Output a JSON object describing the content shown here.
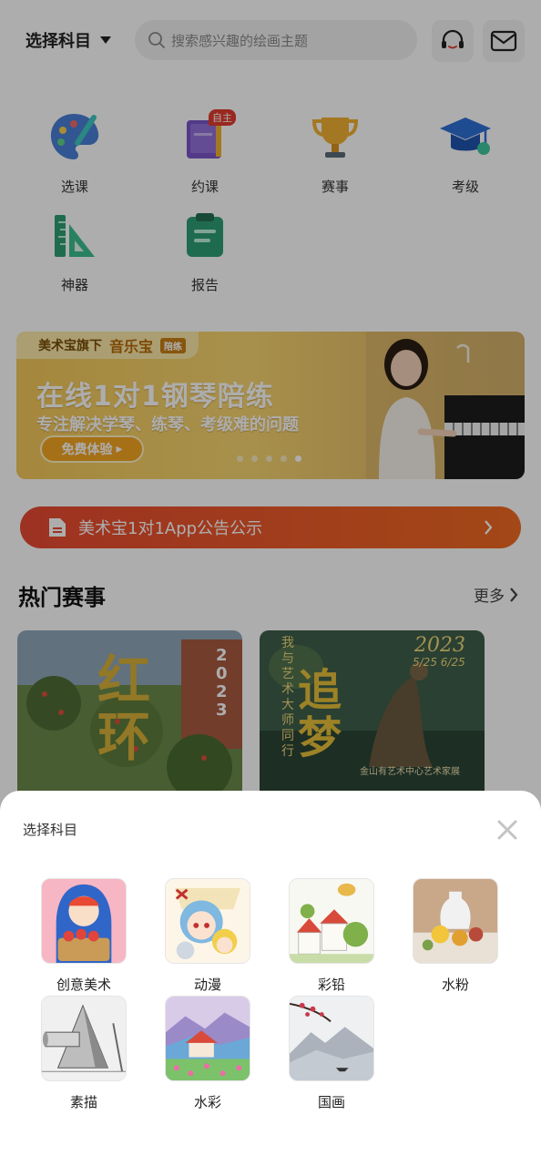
{
  "header": {
    "subject_label": "选择科目",
    "search_placeholder": "搜索感兴趣的绘画主题"
  },
  "menu": [
    {
      "label": "选课",
      "icon": "palette-icon"
    },
    {
      "label": "约课",
      "icon": "book-icon",
      "badge": "自主"
    },
    {
      "label": "赛事",
      "icon": "trophy-icon"
    },
    {
      "label": "考级",
      "icon": "graduation-cap-icon"
    },
    {
      "label": "神器",
      "icon": "ruler-icon"
    },
    {
      "label": "报告",
      "icon": "clipboard-icon"
    }
  ],
  "banner": {
    "tag_prefix": "美术宝旗下",
    "tag_brand": "音乐宝",
    "tag_small": "陪练",
    "headline": "在线1对1钢琴陪练",
    "subline": "专注解决学琴、练琴、考级难的问题",
    "cta": "免费体验",
    "active_dot": 5
  },
  "notice": {
    "text": "美术宝1对1App公告公示"
  },
  "hot_events": {
    "title": "热门赛事",
    "more": "更多",
    "cards": [
      {
        "title": "红环",
        "year": "2023"
      },
      {
        "title": "追梦",
        "side_text": "我与艺术大师同行",
        "year": "2023",
        "dates": "5/25 6/25",
        "org": "金山有艺术中心艺术家展"
      }
    ]
  },
  "sheet": {
    "title": "选择科目",
    "subjects": [
      {
        "name": "创意美术"
      },
      {
        "name": "动漫"
      },
      {
        "name": "彩铅"
      },
      {
        "name": "水粉"
      },
      {
        "name": "素描"
      },
      {
        "name": "水彩"
      },
      {
        "name": "国画"
      }
    ]
  },
  "colors": {
    "notice_start": "#e94a33",
    "notice_end": "#f06a22",
    "badge": "#e23b2e",
    "banner": "#f3c85a"
  }
}
